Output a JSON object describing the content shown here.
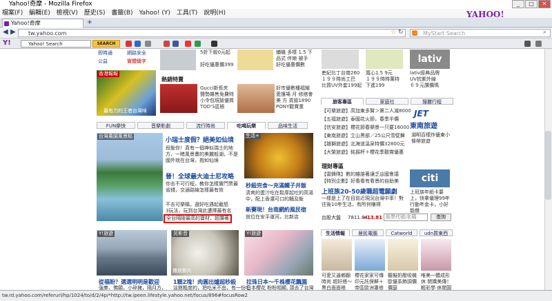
{
  "window": {
    "title": "Yahoo!奇摩 - Mozilla Firefox",
    "min": "_",
    "max": "□",
    "close": "✕"
  },
  "menu": [
    "檔案(F)",
    "編輯(E)",
    "檢視(V)",
    "歷史(S)",
    "書籤(B)",
    "Yahoo! (Y)",
    "工具(T)",
    "說明(H)"
  ],
  "brand": "YAHOO!",
  "tab": {
    "label": "Yahoo!奇摩",
    "new_tab": "+"
  },
  "nav": {
    "url": "tw.yahoo.com",
    "search_placeholder": "MyStart Search"
  },
  "ytoolbar": {
    "logo": "Y!",
    "search_value": "Yahoo! Search",
    "search_btn": "SEARCH"
  },
  "left": {
    "top_links": [
      "即時通",
      "網路安全",
      "公益",
      "實體鑄字"
    ],
    "promo_label": "香港報報",
    "promo_caption": "最有力的王者台灣味"
  },
  "mid": {
    "top_texts": [
      "5折下殺0元起",
      "好吃優惠價399",
      "鋪機 多樣 1.5 下",
      "品式 伴娘 被手",
      "好吃優惠價數"
    ],
    "shop_title": "熱銷特賣",
    "shop1": [
      "Gucci新長夾",
      "聲勢雜售免費特",
      "小令包現搶優質",
      "TOD'S區賬"
    ],
    "shop2": [
      "好市優數種福耀",
      "愛護場 月 修搭會",
      "美 方 貨搶1890",
      "PONY觀賞重"
    ]
  },
  "tabs": [
    "FUN樂快",
    "音樂影劇",
    "流行時尚",
    "吃喝玩樂",
    "品味生活"
  ],
  "feature": {
    "img_label": "台灣農園風景點",
    "headline": "小瑞士度假？絕美如仙境",
    "desc": "段飯你！真有一個神似瑞士的地方，一睹風景畫的美麗般湖，不是國外就在台灣，抱如仙境",
    "headline2": "晉！全球最大迪士尼攻略",
    "desc2": "你去不可行程，教你怎樣實門票最省錢，交通路線怎樣最有效",
    "links": [
      "不去可樂稱，選好吃遇起截怒",
      "3玩法，玩到台灣此遭擇最有名",
      "全台隔陵最高的寶材，超讚著"
    ],
    "side_label": "生活+",
    "side_title": "秒殺完食～充滿鐵子井飯",
    "side_desc": "清爽的蛋汁吃在鬆厚起吐的高湯中，配上香濃可口的麵及飯",
    "side_title2": "新賽現！台南網約風民宿",
    "side_desc2": "就位在安平運河，比新店"
  },
  "bottom": {
    "labels": [
      "Y!旅遊",
      "另影音",
      "Y!旅遊"
    ],
    "play": "播放影片",
    "titles": [
      "從福盼？選選明明是歡迎",
      "1顆2塊！肉圓出爐超秒殺",
      "拉珠日本～千株櫻花飄園"
    ],
    "descs": [
      "強衆、佛願，小碎擁，隔月方，",
      "這館粗度的，把吃米不由，有一份吃",
      "日本櫻花 粉粉相顯, 頭去了台灣"
    ]
  },
  "right": {
    "top_products": [
      "吏紀比丁台南260",
      "１９９時尚工巴",
      "比買UV外套199起"
    ],
    "top_products2": [
      "寬心1.5 9元",
      "１９９時時萬特",
      "下進199"
    ],
    "top_products3": [
      "lativ經典品牌",
      "UV抗紫外線",
      "６９元讚價瑪"
    ],
    "lativ": "lativ",
    "news_tabs": [
      "旅客專區",
      "家庭社",
      "搜麗行程"
    ],
    "news": [
      "【可樂旅遊】高加東多賢＞第二人滅8000",
      "【五福旅遊】泰國花火節，春季半價",
      "【信安旅遊】櫻花節春樂景一只要16000",
      "【東南旅遊】立山黑部／25公尺雪壁舞",
      "【雄獅旅遊】北海道溫泉特價32800元",
      "【大榮旅遊】銘振杯＋櫻花季觀賞優惠"
    ],
    "jet": "JET",
    "jet_name": "東南旅遊",
    "jet_desc": "湖明百樣炸優東小條帶旅遊",
    "finance_title": "理財專區",
    "finance": [
      "【雷鋒隊】數的雜誰著讓乏這國會議",
      "【特別企劃】好看看有看景的自助美"
    ],
    "finance_head": "上班族20-50歲職超電願劇",
    "finance_desc": "一樣是上了在目前近現況台灣中率！對往後10年生活，有所何賺得",
    "citi": "citi",
    "citi_desc": "上班族年紙卡要上，快拿優理99年行動年金卡，小好能繳",
    "stock_label": "台股大盤",
    "stock_value": "7811.84",
    "stock_change": "+13.81",
    "stock_placeholder": "股票代號/名稱",
    "stock_btn": "查詢",
    "life_tabs": [
      "生活情報",
      "居民電腦",
      "Catworld",
      "udn買東西"
    ],
    "life_products": [
      "可愛又逼鄉翻時尚 超好搭～黑白面面褡",
      "櫻花家家可傳 印元託保鮮＋帝區歐洲專修",
      "聽擬奶壓吸機歐優系飾調價價瑟",
      "唯美一體成形休 閒嬌美傳！輕彩學 休閒圓短袖褐"
    ]
  },
  "status": "tw.rd.yahoo.com/referurl/hp/1024/to/d/2/4p/*http://tw.ipeen.lifestyle.yahoo.net/focus/896#focusRow2"
}
